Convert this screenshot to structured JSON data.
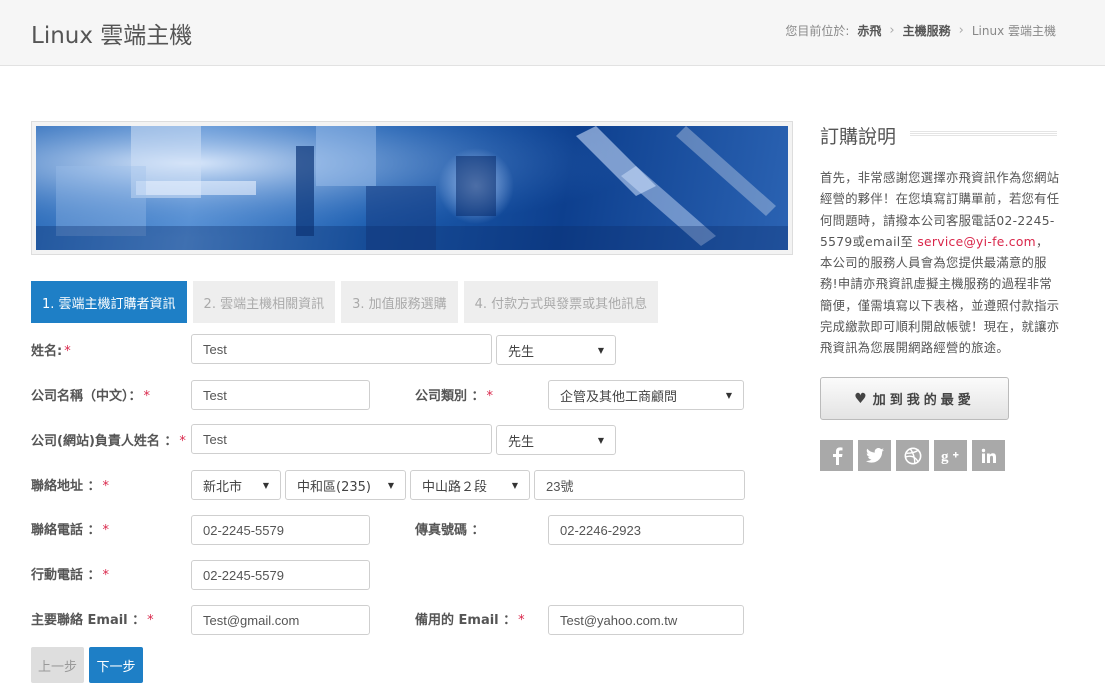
{
  "header": {
    "title": "Linux 雲端主機",
    "breadcrumb": {
      "prefix": "您目前位於:",
      "items": [
        "赤飛",
        "主機服務",
        "Linux 雲端主機"
      ]
    }
  },
  "tabs": [
    {
      "label": "1. 雲端主機訂購者資訊",
      "active": true
    },
    {
      "label": "2. 雲端主機相關資訊",
      "active": false
    },
    {
      "label": "3. 加值服務選購",
      "active": false
    },
    {
      "label": "4. 付款方式與發票或其他訊息",
      "active": false
    }
  ],
  "form": {
    "required_mark": "*",
    "name": {
      "label": "姓名:",
      "value": "Test",
      "title_select": "先生"
    },
    "company": {
      "label": "公司名稱（中文）：",
      "value": "Test"
    },
    "company_type": {
      "label": "公司類別 ：",
      "value": "企管及其他工商顧問"
    },
    "owner": {
      "label": "公司(網站)負責人姓名 ：",
      "value": "Test",
      "title_select": "先生"
    },
    "address": {
      "label": "聯絡地址 ：",
      "city": "新北市",
      "district": "中和區(235)",
      "road": "中山路２段",
      "number": "23號"
    },
    "phone": {
      "label": "聯絡電話 ：",
      "value": "02-2245-5579"
    },
    "fax": {
      "label": "傳真號碼 ：",
      "value": "02-2246-2923"
    },
    "mobile": {
      "label": "行動電話 ：",
      "value": "02-2245-5579"
    },
    "email": {
      "label": "主要聯絡 Email ：",
      "value": "Test@gmail.com"
    },
    "backup_email": {
      "label": "備用的 Email ：",
      "value": "Test@yahoo.com.tw"
    },
    "buttons": {
      "prev": "上一步",
      "next": "下一步"
    }
  },
  "sidebar": {
    "title": "訂購說明",
    "text_before": "首先，非常感謝您選擇亦飛資訊作為您網站經營的夥伴！在您填寫訂購單前，若您有任何問題時，請撥本公司客服電話02-2245-5579或email至 ",
    "email": "service@yi-fe.com",
    "text_after": "，本公司的服務人員會為您提供最滿意的服務!申請亦飛資訊虛擬主機服務的過程非常簡便，僅需填寫以下表格，並遵照付款指示完成繳款即可順利開啟帳號！現在，就讓亦飛資訊為您展開網路經營的旅途。",
    "favorite_label": "加到我的最愛",
    "social_icons": [
      "facebook-icon",
      "twitter-icon",
      "dribbble-icon",
      "google-plus-icon",
      "linkedin-icon"
    ]
  },
  "colors": {
    "accent": "#1e7fc6",
    "required": "#d9264a",
    "link": "#d9264a"
  }
}
